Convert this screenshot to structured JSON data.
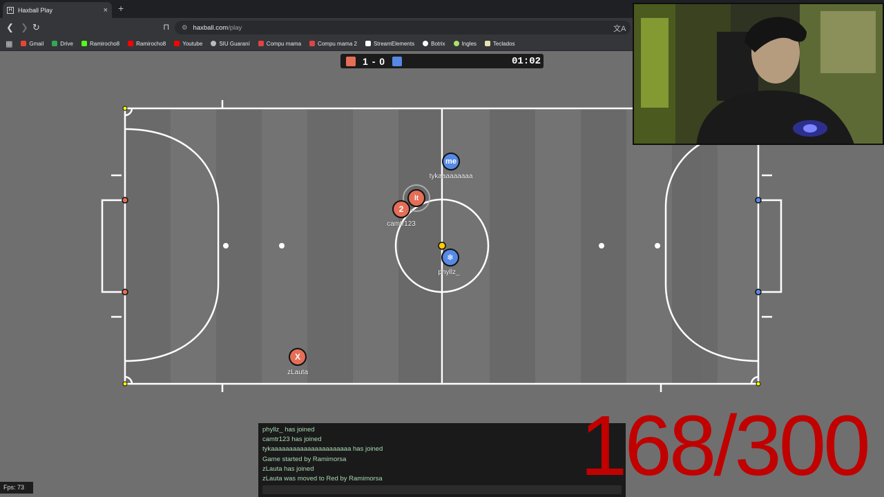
{
  "browser": {
    "tab_title": "Haxball Play",
    "favicon_label": "H",
    "close_label": "×",
    "newtab_label": "+",
    "url_host": "haxball.com",
    "url_path": "/play",
    "bookmarks": [
      {
        "label": "Gmail",
        "color": "#ea4335"
      },
      {
        "label": "Drive",
        "color": "#34a853"
      },
      {
        "label": "Ramirocho8",
        "color": "#53fc18"
      },
      {
        "label": "Ramirocho8",
        "color": "#ff0000"
      },
      {
        "label": "Youtube",
        "color": "#ff0000"
      },
      {
        "label": "SIU Guaraní",
        "color": "#bbbbbb"
      },
      {
        "label": "Compu mama",
        "color": "#e04444"
      },
      {
        "label": "Compu mama 2",
        "color": "#e04444"
      },
      {
        "label": "StreamElements",
        "color": "#ffffff"
      },
      {
        "label": "Botrix",
        "color": "#ffffff"
      },
      {
        "label": "Ingles",
        "color": "#a9e26b"
      },
      {
        "label": "Teclados",
        "color": "#e8e2b0"
      }
    ]
  },
  "scoreboard": {
    "red_score": "1",
    "separator": "-",
    "blue_score": "0",
    "time": "01:02",
    "red_color": "#e56e56",
    "blue_color": "#5689e5"
  },
  "players": [
    {
      "name": "tykaaaaaaaaa",
      "avatar": "me",
      "team": "blue"
    },
    {
      "name": "camtr123",
      "avatar": "2",
      "team": "red"
    },
    {
      "name": "",
      "avatar": "lt",
      "team": "red"
    },
    {
      "name": "phyllz_",
      "avatar": "❄",
      "team": "blue"
    },
    {
      "name": "zLauta",
      "avatar": "X",
      "team": "red"
    }
  ],
  "chat": {
    "messages": [
      "phyllz_ has joined",
      "camtr123 has joined",
      "tykaaaaaaaaaaaaaaaaaaaaaa has joined",
      "Game started by Ramimorsa",
      "zLauta has joined",
      "zLauta was moved to Red by Ramimorsa"
    ]
  },
  "fps": "Fps: 73",
  "counter": "168/300"
}
